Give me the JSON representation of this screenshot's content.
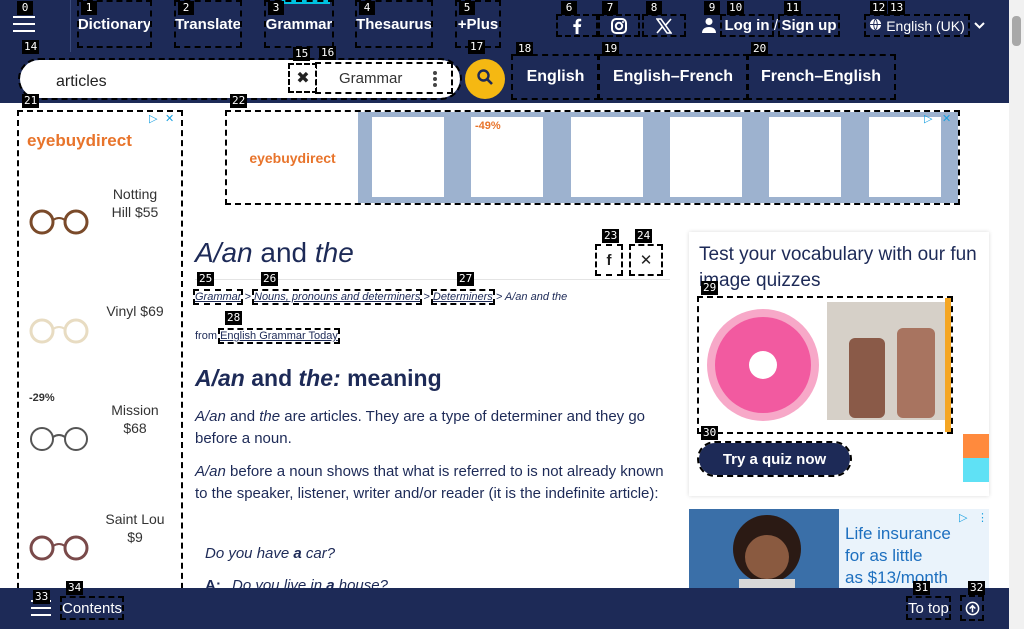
{
  "nav": {
    "items": [
      {
        "label": "Dictionary"
      },
      {
        "label": "Translate"
      },
      {
        "label": "Grammar"
      },
      {
        "label": "Thesaurus"
      },
      {
        "label": "+Plus"
      }
    ],
    "login": "Log in",
    "slash": "/",
    "signup": "Sign up",
    "language": "English (UK)"
  },
  "search": {
    "value": "articles",
    "dictionary": "Grammar",
    "tabs": [
      "English",
      "English–French",
      "French–English"
    ]
  },
  "left_ad": {
    "brand": "eyebuydirect",
    "discount": "-29%",
    "products": [
      {
        "name": "Notting Hill $55"
      },
      {
        "name": "Vinyl $69"
      },
      {
        "name": "Mission $68"
      },
      {
        "name": "Saint Lou $9"
      }
    ]
  },
  "top_ad": {
    "brand": "eyebuydirect",
    "discount": "-49%"
  },
  "article": {
    "title_a": "A/an",
    "title_and": " and ",
    "title_the": "the",
    "crumbs": [
      "Grammar",
      "Nouns, pronouns and determiners",
      "Determiners"
    ],
    "crumb_sep": " > ",
    "crumb_current": " > A/an and the",
    "from_prefix": "from",
    "from_link": "English Grammar Today",
    "h2_a": "A/an",
    "h2_and": " and ",
    "h2_the": "the:",
    "h2_rest": " meaning",
    "p1_a": "A/an",
    "p1_and": " and ",
    "p1_the": "the",
    "p1_rest": " are articles. They are a type of determiner and they go before a noun.",
    "p2_a": "A/an",
    "p2_rest": " before a noun shows that what is referred to is not already known to the speaker, listener, writer and/or reader (it is the indefinite article):",
    "ex1_pre": "Do you have ",
    "ex1_bold": "a",
    "ex1_post": " car?",
    "ex2_speaker": "A:",
    "ex2_pre": "Do you live in ",
    "ex2_bold": "a",
    "ex2_post": " house?"
  },
  "quiz": {
    "title": "Test your vocabulary with our fun image quizzes",
    "button": "Try a quiz now"
  },
  "right_ad": {
    "line1": "Life insurance",
    "line2": "for as little",
    "line3": "as $13/month"
  },
  "bottom": {
    "contents": "Contents",
    "to_top": "To top"
  },
  "tags": [
    "0",
    "1",
    "2",
    "3",
    "4",
    "5",
    "6",
    "7",
    "8",
    "9",
    "10",
    "11",
    "12",
    "13",
    "14",
    "15",
    "16",
    "17",
    "18",
    "19",
    "20",
    "21",
    "22",
    "23",
    "24",
    "25",
    "26",
    "27",
    "28",
    "29",
    "30",
    "31",
    "32",
    "33",
    "34"
  ],
  "colors": {
    "navy": "#1d2a57",
    "accent": "#f5b812",
    "cyan": "#00c2e0"
  }
}
